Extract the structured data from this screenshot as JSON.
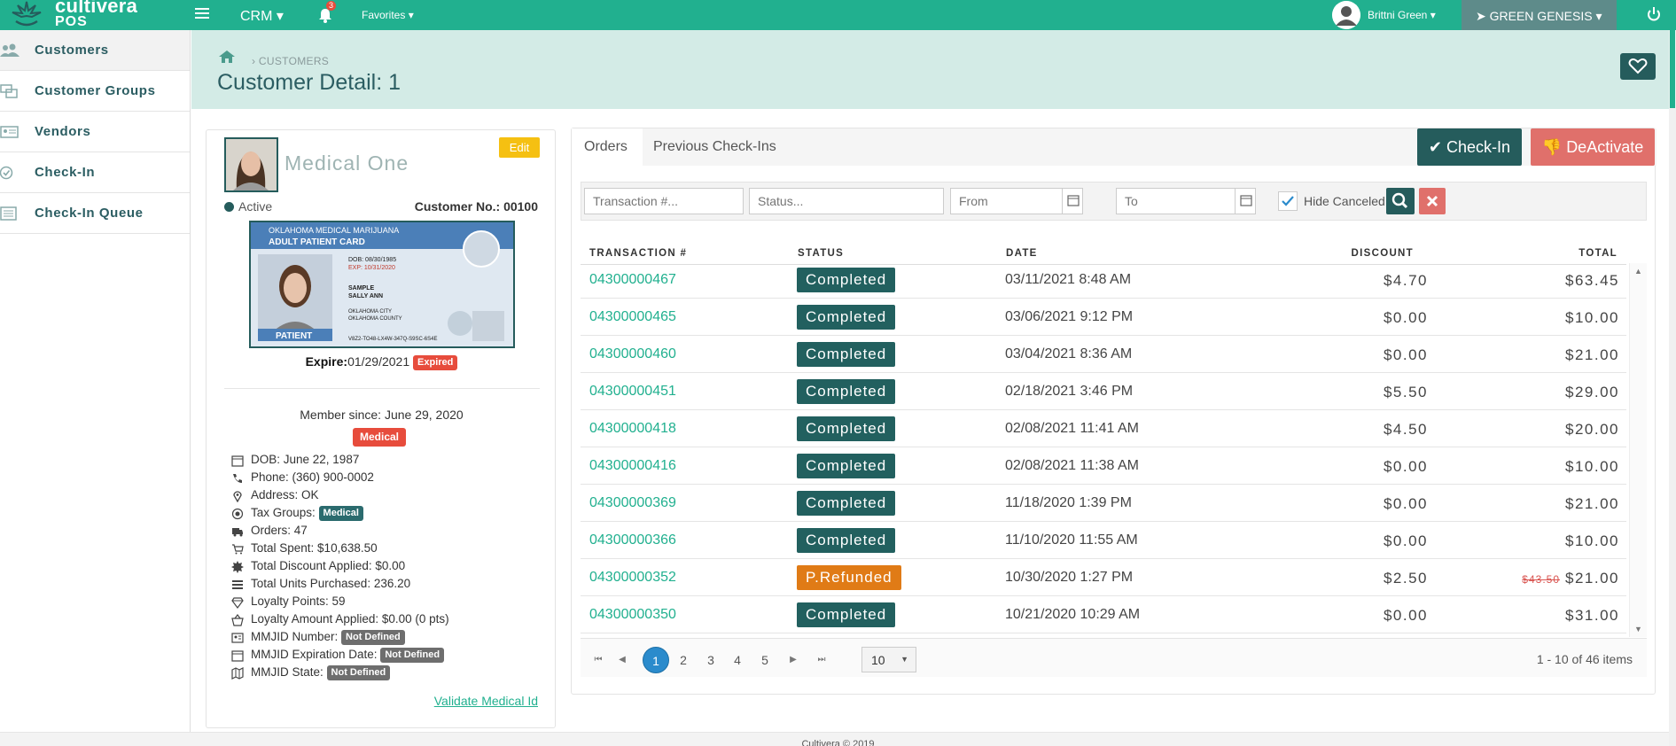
{
  "topbar": {
    "logo_line1": "cultivera",
    "logo_line2": "POS",
    "module": "CRM",
    "module_caret": "▾",
    "notifications_count": "3",
    "favorites": "Favorites",
    "favorites_caret": "▾",
    "user_name": "Brittni Green",
    "user_caret": "▾",
    "store_name": "GREEN GENESIS",
    "store_caret": "▾",
    "accent_color": "#21b08f"
  },
  "sidebar": {
    "items": [
      {
        "label": "Customers",
        "icon": "users-icon"
      },
      {
        "label": "Customer Groups",
        "icon": "groups-icon"
      },
      {
        "label": "Vendors",
        "icon": "vendor-card-icon"
      },
      {
        "label": "Check-In",
        "icon": "check-circle-icon"
      },
      {
        "label": "Check-In Queue",
        "icon": "list-icon"
      }
    ]
  },
  "header": {
    "breadcrumb": "› CUSTOMERS",
    "title": "Customer Detail: 1"
  },
  "customer": {
    "name": "Medical One",
    "edit_label": "Edit",
    "status": "Active",
    "customer_no_label": "Customer No.:",
    "customer_no": "00100",
    "expire_label": "Expire:",
    "expire_date": "01/29/2021",
    "expired_badge": "Expired",
    "member_since": "Member since: June 29, 2020",
    "type_badge": "Medical",
    "dob": "DOB: June 22, 1987",
    "phone": "Phone: (360) 900-0002",
    "address": "Address: OK",
    "tax_groups_label": "Tax Groups:",
    "tax_groups_badge": "Medical",
    "orders": "Orders: 47",
    "total_spent": "Total Spent: $10,638.50",
    "total_discount": "Total Discount Applied: $0.00",
    "total_units": "Total Units Purchased: 236.20",
    "loyalty_points": "Loyalty Points: 59",
    "loyalty_amount": "Loyalty Amount Applied: $0.00 (0 pts)",
    "mmjid_number_label": "MMJID Number:",
    "mmjid_expiration_label": "MMJID Expiration Date:",
    "mmjid_state_label": "MMJID State:",
    "not_defined": "Not Defined",
    "validate_link": "Validate Medical Id"
  },
  "id_card": {
    "header1": "OKLAHOMA MEDICAL MARIJUANA",
    "header2": "ADULT PATIENT CARD",
    "dob": "DOB: 08/30/1985",
    "exp": "EXP: 10/31/2020",
    "name1": "SAMPLE",
    "name2": "SALLY ANN",
    "city": "OKLAHOMA CITY",
    "county": "OKLAHOMA COUNTY",
    "patient_label": "PATIENT",
    "patient_id": "V8Z2-TO48-LX4W-347Q-S9SC-6S4E"
  },
  "orders_panel": {
    "tabs": [
      "Orders",
      "Previous Check-Ins"
    ],
    "checkin_label": "Check-In",
    "deactivate_label": "DeActivate",
    "filters": {
      "transaction_placeholder": "Transaction #...",
      "status_placeholder": "Status...",
      "from_placeholder": "From",
      "to_placeholder": "To",
      "hide_canceled_label": "Hide Canceled"
    },
    "columns": [
      "TRANSACTION #",
      "STATUS",
      "DATE",
      "DISCOUNT",
      "TOTAL"
    ],
    "rows": [
      {
        "txn": "04300000467",
        "status": "Completed",
        "date": "03/11/2021 8:48 AM",
        "discount": "$4.70",
        "total": "$63.45",
        "original_total": ""
      },
      {
        "txn": "04300000465",
        "status": "Completed",
        "date": "03/06/2021 9:12 PM",
        "discount": "$0.00",
        "total": "$10.00",
        "original_total": ""
      },
      {
        "txn": "04300000460",
        "status": "Completed",
        "date": "03/04/2021 8:36 AM",
        "discount": "$0.00",
        "total": "$21.00",
        "original_total": ""
      },
      {
        "txn": "04300000451",
        "status": "Completed",
        "date": "02/18/2021 3:46 PM",
        "discount": "$5.50",
        "total": "$29.00",
        "original_total": ""
      },
      {
        "txn": "04300000418",
        "status": "Completed",
        "date": "02/08/2021 11:41 AM",
        "discount": "$4.50",
        "total": "$20.00",
        "original_total": ""
      },
      {
        "txn": "04300000416",
        "status": "Completed",
        "date": "02/08/2021 11:38 AM",
        "discount": "$0.00",
        "total": "$10.00",
        "original_total": ""
      },
      {
        "txn": "04300000369",
        "status": "Completed",
        "date": "11/18/2020 1:39 PM",
        "discount": "$0.00",
        "total": "$21.00",
        "original_total": ""
      },
      {
        "txn": "04300000366",
        "status": "Completed",
        "date": "11/10/2020 11:55 AM",
        "discount": "$0.00",
        "total": "$10.00",
        "original_total": ""
      },
      {
        "txn": "04300000352",
        "status": "P.Refunded",
        "date": "10/30/2020 1:27 PM",
        "discount": "$2.50",
        "total": "$21.00",
        "original_total": "$43.50"
      },
      {
        "txn": "04300000350",
        "status": "Completed",
        "date": "10/21/2020 10:29 AM",
        "discount": "$0.00",
        "total": "$31.00",
        "original_total": ""
      }
    ],
    "pager": {
      "pages": [
        "1",
        "2",
        "3",
        "4",
        "5"
      ],
      "current_page": "1",
      "page_size": "10",
      "info": "1 - 10 of 46 items"
    }
  },
  "footer": {
    "text": "Cultivera © 2019"
  }
}
